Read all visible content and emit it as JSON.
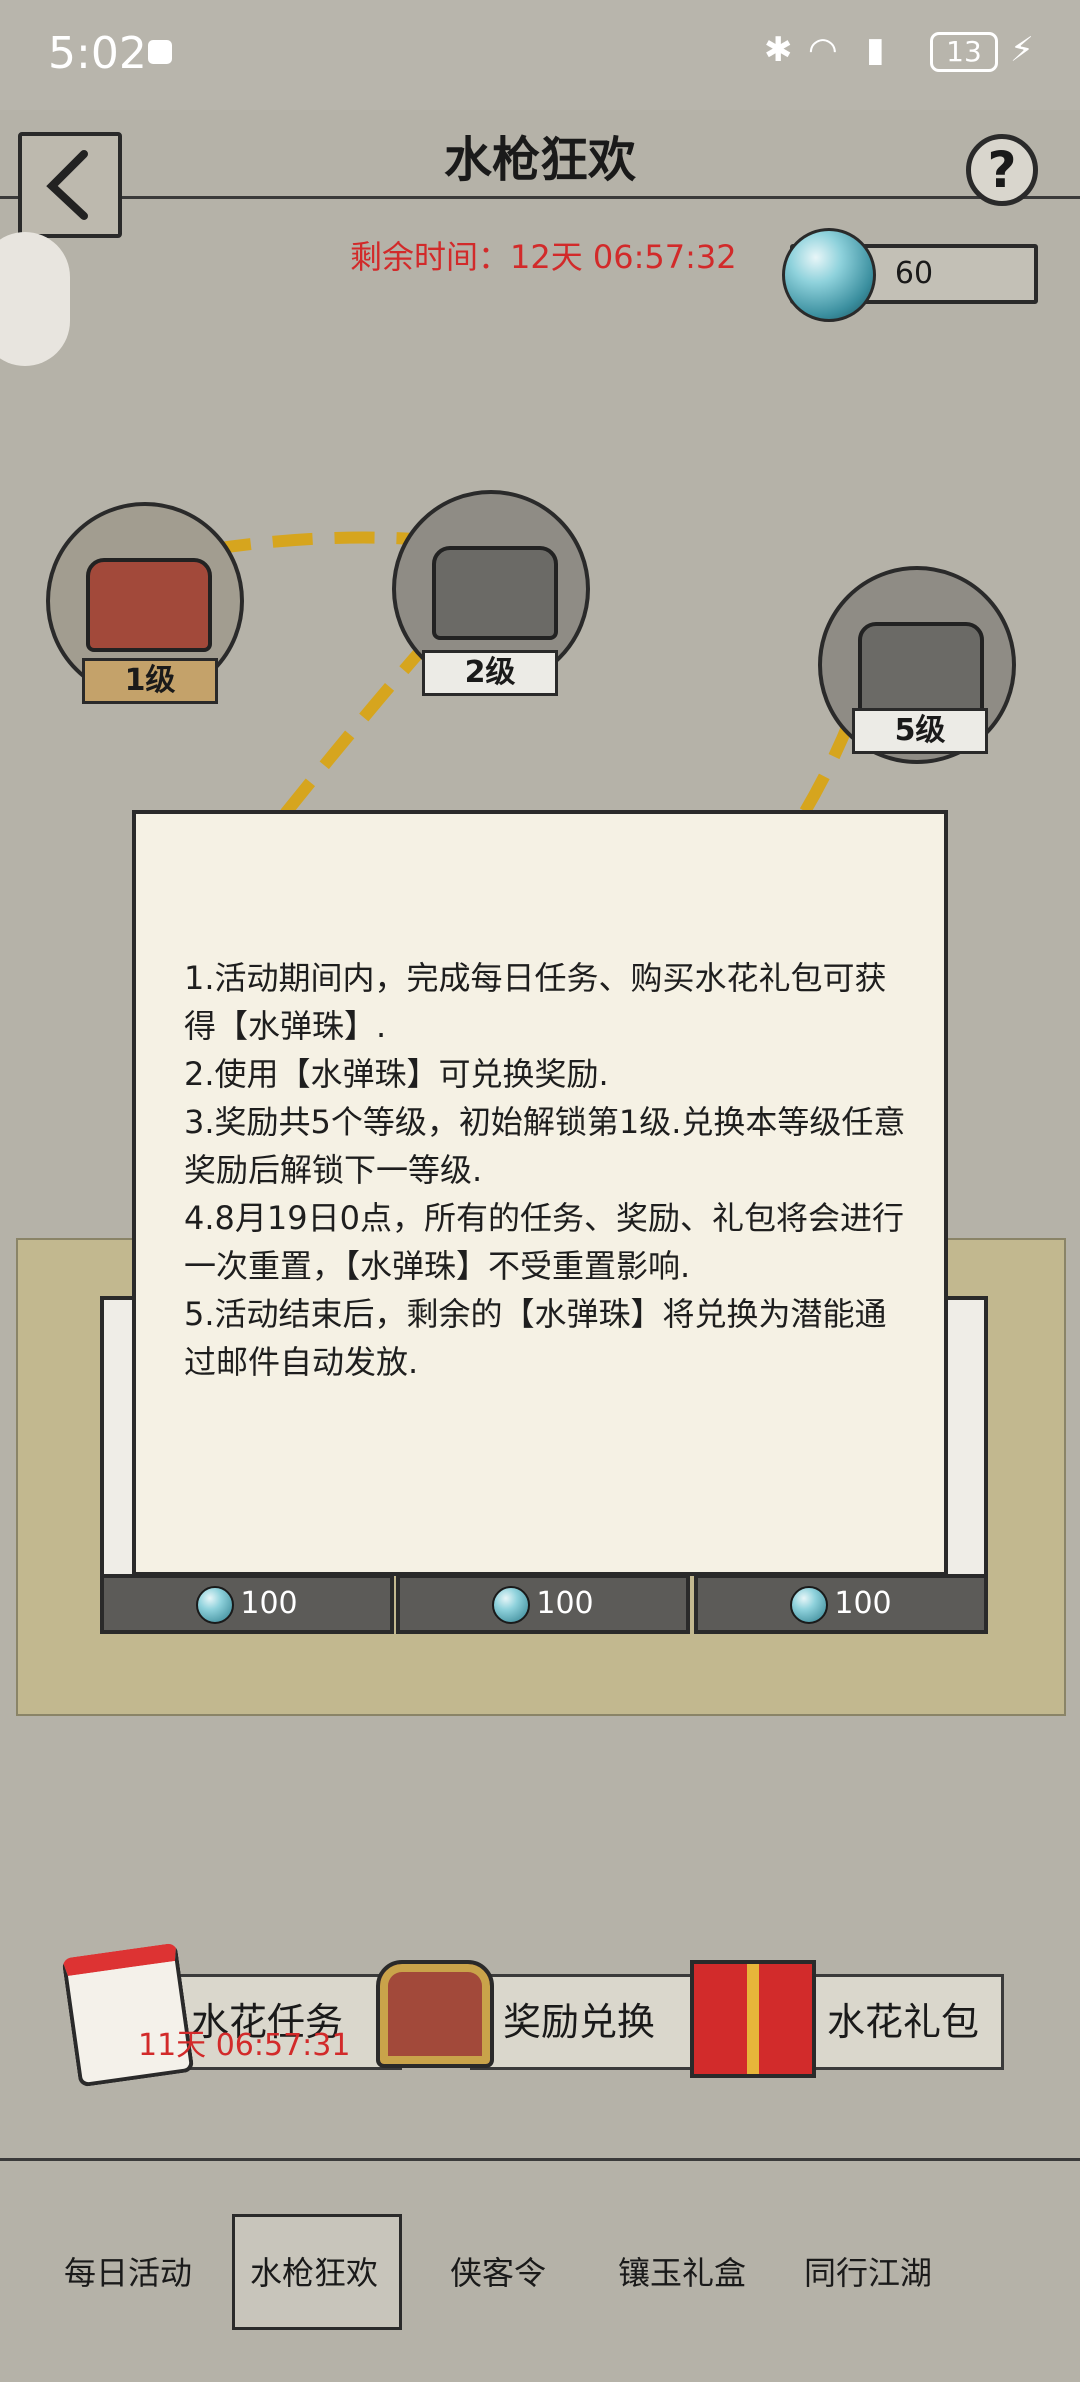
{
  "status_bar": {
    "time": "5:02",
    "battery": "13"
  },
  "header": {
    "title": "水枪狂欢",
    "help": "?"
  },
  "timer": "剩余时间：12天 06:57:32",
  "currency_amount": "60",
  "levels": [
    "1级",
    "2级",
    "5级"
  ],
  "rules": [
    "1.活动期间内，完成每日任务、购买水花礼包可获得【水弹珠】.",
    "2.使用【水弹珠】可兑换奖励.",
    "3.奖励共5个等级，初始解锁第1级.兑换本等级任意奖励后解锁下一等级.",
    "4.8月19日0点，所有的任务、奖励、礼包将会进行一次重置，【水弹珠】不受重置影响.",
    "5.活动结束后，剩余的【水弹珠】将兑换为潜能通过邮件自动发放."
  ],
  "reward_costs": [
    "100",
    "100",
    "100"
  ],
  "actions": {
    "task_label": "水花任务",
    "task_countdown": "11天 06:57:31",
    "exchange_label": "奖励兑换",
    "gift_label": "水花礼包"
  },
  "nav_tabs": [
    "每日活动",
    "水枪狂欢",
    "侠客令",
    "镶玉礼盒",
    "同行江湖"
  ],
  "colors": {
    "timer_red": "#d22a2a",
    "dialog_bg": "#f5f1e4",
    "gold_path": "#d6a51e"
  }
}
